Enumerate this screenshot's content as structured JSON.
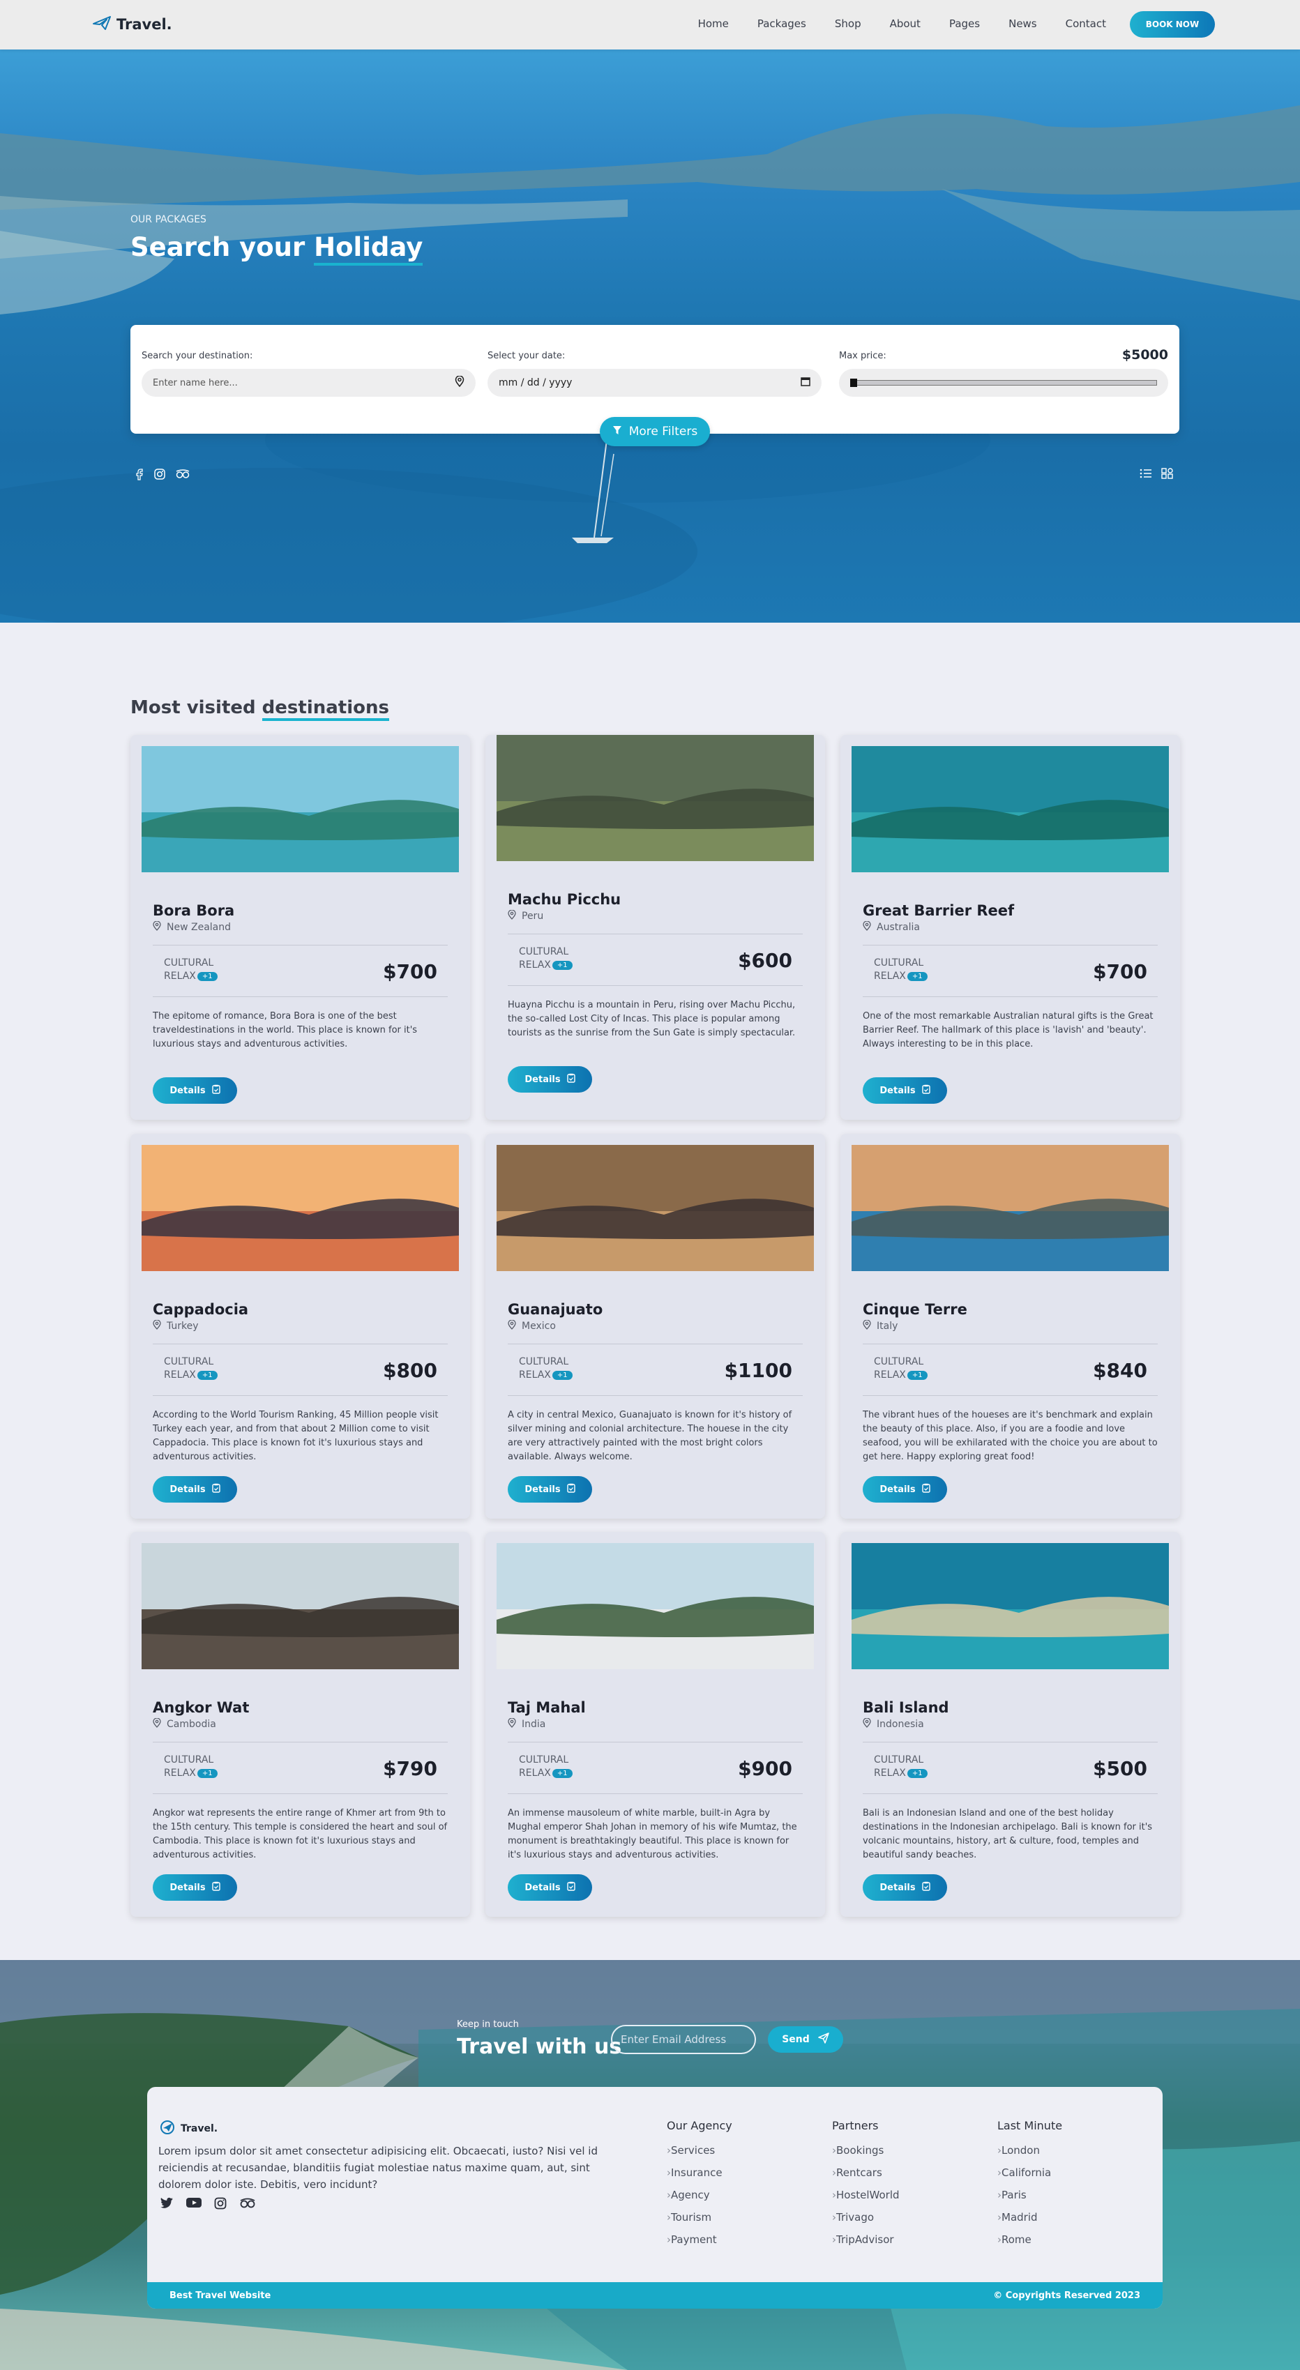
{
  "nav": {
    "brand": "Travel.",
    "links": [
      "Home",
      "Packages",
      "Shop",
      "About",
      "Pages",
      "News",
      "Contact"
    ],
    "cta": "BOOK NOW"
  },
  "hero": {
    "eyebrow": "OUR PACKAGES",
    "title_prefix": "Search your ",
    "title_highlight": "Holiday",
    "search": {
      "destination_label": "Search your destination:",
      "destination_placeholder": "Enter name here...",
      "date_label": "Select your date:",
      "date_value": "mm / dd / yyyy",
      "price_label": "Max price:",
      "price_value": "$5000",
      "price_slider_fraction": 0
    },
    "more_filters": "More Filters"
  },
  "destinations": {
    "title_prefix": "Most visited ",
    "title_highlight": "destinations",
    "tag1": "CULTURAL",
    "tag2": "RELAX",
    "badge": "+1",
    "details_label": "Details",
    "cards": [
      {
        "name": "Bora Bora",
        "country": "New Zealand",
        "price": "$700",
        "desc": "The epitome of romance, Bora Bora is one of the best traveldestinations in the world. This place is known for it's luxurious stays and adventurous activities."
      },
      {
        "name": "Machu Picchu",
        "country": "Peru",
        "price": "$600",
        "desc": "Huayna Picchu is a mountain in Peru, rising over Machu Picchu, the so-called Lost City of Incas. This place is popular among tourists as the sunrise from the Sun Gate is simply spectacular."
      },
      {
        "name": "Great Barrier Reef",
        "country": "Australia",
        "price": "$700",
        "desc": "One of the most remarkable Australian natural gifts is the Great Barrier Reef. The hallmark of this place is 'lavish' and 'beauty'. Always interesting to be in this place."
      },
      {
        "name": "Cappadocia",
        "country": "Turkey",
        "price": "$800",
        "desc": "According to the World Tourism Ranking, 45 Million people visit Turkey each year, and from that about 2 Million come to visit Cappadocia. This place is known fot it's luxurious stays and adventurous activities."
      },
      {
        "name": "Guanajuato",
        "country": "Mexico",
        "price": "$1100",
        "desc": "A city in central Mexico, Guanajuato is known for it's history of silver mining and colonial architecture. The houese in the city are very attractively painted with the most bright colors available. Always welcome."
      },
      {
        "name": "Cinque Terre",
        "country": "Italy",
        "price": "$840",
        "desc": "The vibrant hues of the houeses are it's benchmark and explain the beauty of this place. Also, if you are a foodie and love seafood, you will be exhilarated with the choice you are about to get here. Happy exploring great food!"
      },
      {
        "name": "Angkor Wat",
        "country": "Cambodia",
        "price": "$790",
        "desc": "Angkor wat represents the entire range of Khmer art from 9th to the 15th century. This temple is considered the heart and soul of Cambodia. This place is known fot it's luxurious stays and adventurous activities."
      },
      {
        "name": "Taj Mahal",
        "country": "India",
        "price": "$900",
        "desc": "An immense mausoleum of white marble, built-in Agra by Mughal emperor Shah Johan in memory of his wife Mumtaz, the monument is breathtakingly beautiful. This place is known for it's luxurious stays and adventurous activities."
      },
      {
        "name": "Bali Island",
        "country": "Indonesia",
        "price": "$500",
        "desc": "Bali is an Indonesian Island and one of the best holiday destinations in the Indonesian archipelago. Bali is known for it's volcanic mountains, history, art & culture, food, temples and beautiful sandy beaches."
      }
    ]
  },
  "newsletter": {
    "eyebrow": "Keep in touch",
    "title": "Travel with us",
    "email_placeholder": "Enter Email Address",
    "send": "Send"
  },
  "footer": {
    "brand": "Travel.",
    "about": "Lorem ipsum dolor sit amet consectetur adipisicing elit. Obcaecati, iusto? Nisi vel id reiciendis at recusandae, blanditiis fugiat molestiae natus maxime quam, aut, sint dolorem dolor iste. Debitis, vero incidunt?",
    "columns": [
      {
        "title": "Our Agency",
        "items": [
          "Services",
          "Insurance",
          "Agency",
          "Tourism",
          "Payment"
        ]
      },
      {
        "title": "Partners",
        "items": [
          "Bookings",
          "Rentcars",
          "HostelWorld",
          "Trivago",
          "TripAdvisor"
        ]
      },
      {
        "title": "Last Minute",
        "items": [
          "London",
          "California",
          "Paris",
          "Madrid",
          "Rome"
        ]
      }
    ],
    "bottom_left": "Best Travel Website",
    "bottom_right": "© Copyrights Reserved 2023"
  },
  "colors": {
    "accent": "#19aecf",
    "accent_dark": "#0d78b8",
    "footer_bar": "#18aac8"
  }
}
